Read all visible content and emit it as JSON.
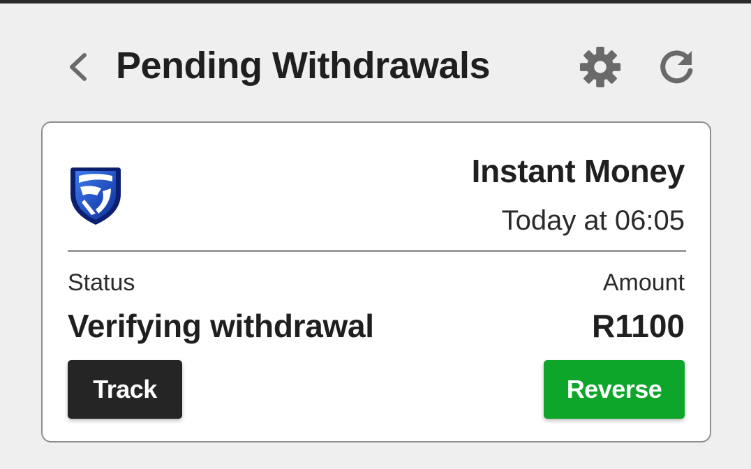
{
  "header": {
    "title": "Pending Withdrawals",
    "back_icon": "chevron-left-icon",
    "settings_icon": "gear-icon",
    "refresh_icon": "refresh-icon"
  },
  "withdrawal": {
    "bank_logo": "standard-bank-logo",
    "provider": "Instant Money",
    "date": "Today at 06:05",
    "status_label": "Status",
    "status_value": "Verifying withdrawal",
    "amount_label": "Amount",
    "amount_value": "R1100",
    "track_label": "Track",
    "reverse_label": "Reverse"
  },
  "colors": {
    "background": "#efefef",
    "card": "#ffffff",
    "track_button": "#252525",
    "reverse_button": "#0da62a",
    "logo_blue": "#1a4fc4"
  }
}
